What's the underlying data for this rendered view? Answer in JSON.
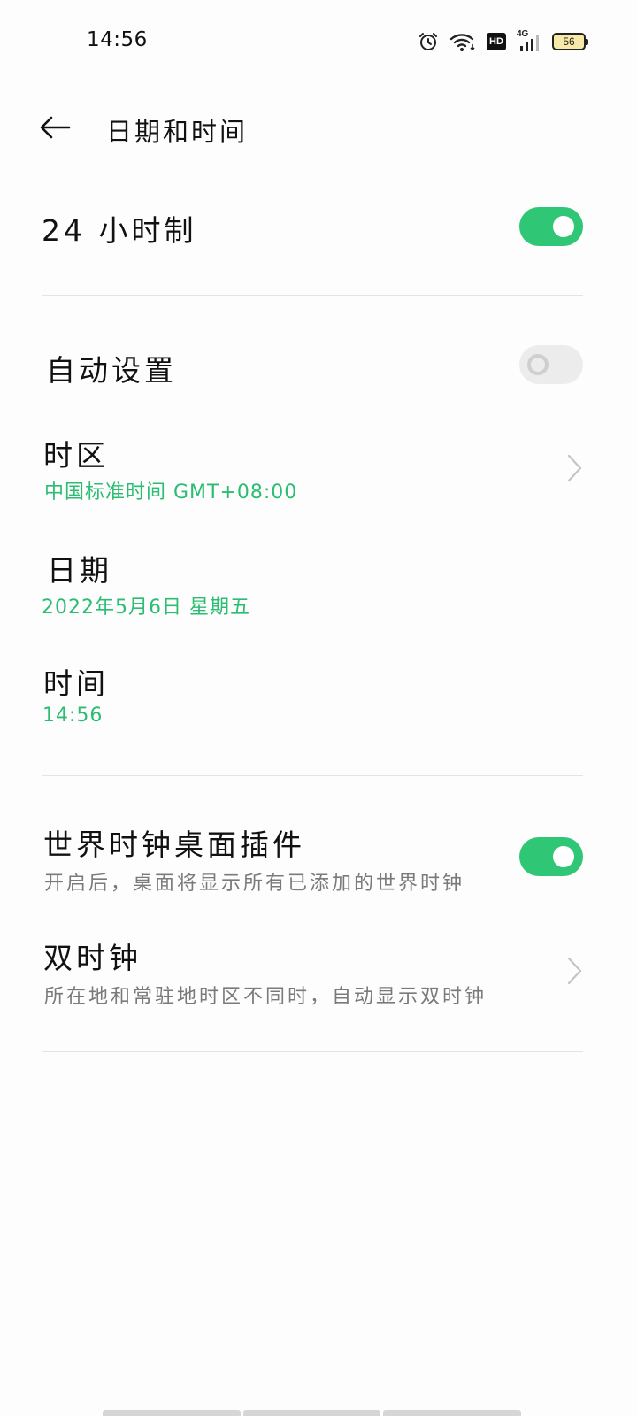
{
  "status_bar": {
    "time": "14:56",
    "icons": [
      "alarm-icon",
      "wifi-icon",
      "hd-icon",
      "4g-signal-icon",
      "battery-icon"
    ],
    "hd_label": "HD",
    "network_label": "4G",
    "battery_level": "56"
  },
  "header": {
    "title": "日期和时间"
  },
  "settings": {
    "hour24": {
      "label": "24 小时制",
      "enabled": true
    },
    "auto_set": {
      "label": "自动设置",
      "enabled": false
    },
    "timezone": {
      "label": "时区",
      "value": "中国标准时间 GMT+08:00"
    },
    "date": {
      "label": "日期",
      "value": "2022年5月6日 星期五"
    },
    "time": {
      "label": "时间",
      "value": "14:56"
    },
    "world_clock_widget": {
      "label": "世界时钟桌面插件",
      "description": "开启后，桌面将显示所有已添加的世界时钟",
      "enabled": true
    },
    "dual_clock": {
      "label": "双时钟",
      "description": "所在地和常驻地时区不同时，自动显示双时钟"
    }
  },
  "colors": {
    "accent": "#2fc776",
    "value_text": "#2bbd72",
    "secondary_text": "#7a7a7a",
    "toggle_off": "#ececec"
  }
}
